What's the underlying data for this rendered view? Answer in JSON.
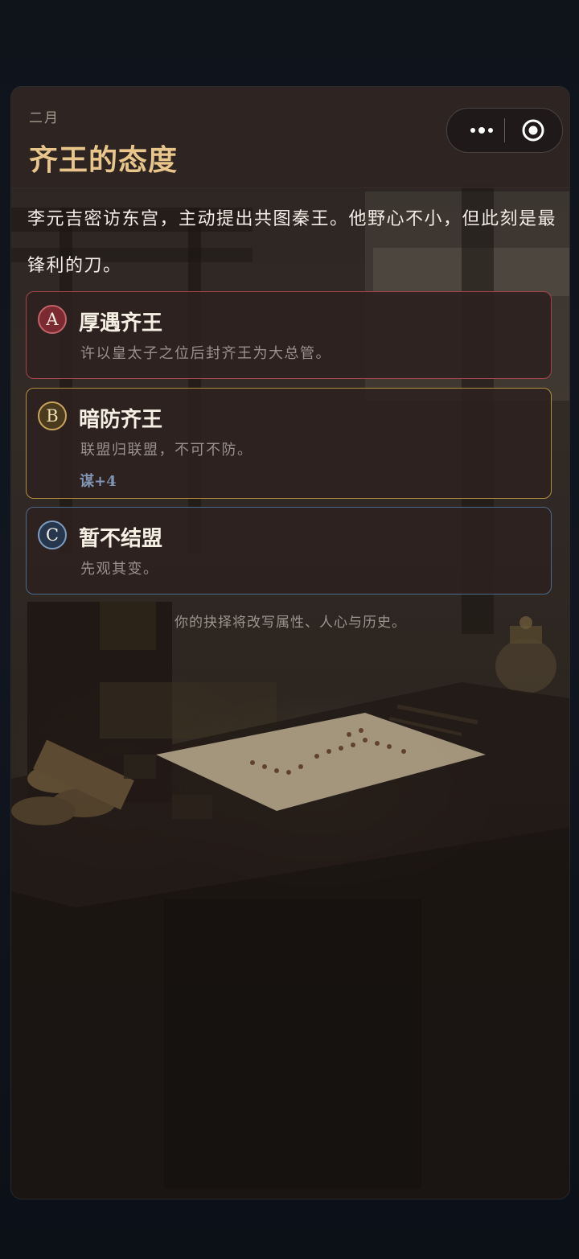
{
  "header": {
    "month": "二月",
    "title": "齐王的态度"
  },
  "capsule": {
    "more_icon": "more-dots-icon",
    "close_icon": "target-circle-icon"
  },
  "narrative": "李元吉密访东宫，主动提出共图秦王。他野心不小，但此刻是最锋利的刀。",
  "options": [
    {
      "key": "A",
      "title": "厚遇齐王",
      "description": "许以皇太子之位后封齐王为大总管。",
      "accent": "#a2454a"
    },
    {
      "key": "B",
      "title": "暗防齐王",
      "description": "联盟归联盟，不可不防。",
      "effect": "谋+4",
      "accent": "#b38d41"
    },
    {
      "key": "C",
      "title": "暂不结盟",
      "description": "先观其变。",
      "accent": "#4c6a8c"
    }
  ],
  "footer_note": "你的抉择将改写属性、人心与历史。",
  "colors": {
    "title_gold": "#e8c58a",
    "background": "#0d1117"
  }
}
